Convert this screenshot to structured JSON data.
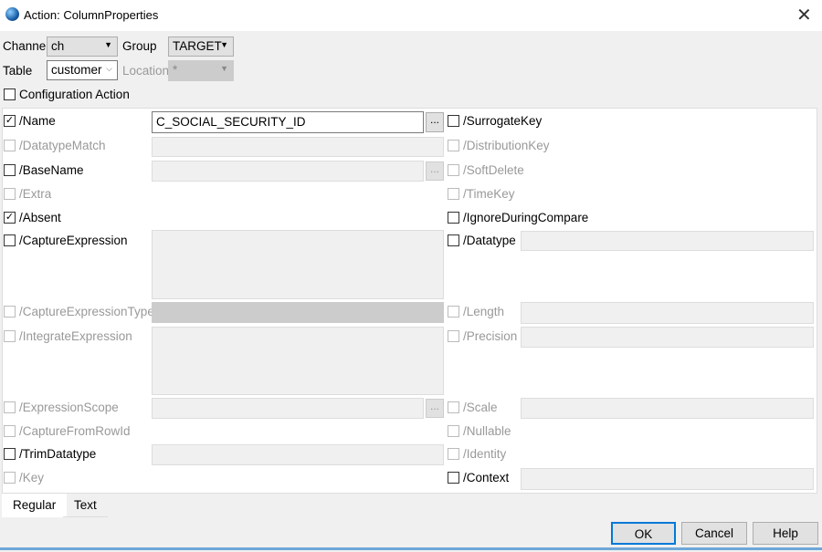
{
  "window": {
    "title": "Action: ColumnProperties",
    "close": "✕"
  },
  "header": {
    "channel_label": "Channel",
    "channel_value": "ch",
    "group_label": "Group",
    "group_value": "TARGET",
    "table_label": "Table",
    "table_value": "customer",
    "location_label": "Location",
    "location_value": "*",
    "config_action_label": "Configuration Action",
    "config_action_checked": false
  },
  "left_rows": [
    {
      "label": "/Name",
      "checked": true,
      "enabled": true,
      "value": "C_SOCIAL_SECURITY_ID"
    },
    {
      "label": "/DatatypeMatch",
      "checked": false,
      "enabled": false
    },
    {
      "label": "/BaseName",
      "checked": false,
      "enabled": true
    },
    {
      "label": "/Extra",
      "checked": false,
      "enabled": false
    },
    {
      "label": "/Absent",
      "checked": true,
      "enabled": true
    },
    {
      "label": "/CaptureExpression",
      "checked": false,
      "enabled": true
    },
    {
      "label": "/CaptureExpressionType",
      "checked": false,
      "enabled": false
    },
    {
      "label": "/IntegrateExpression",
      "checked": false,
      "enabled": false
    },
    {
      "label": "/ExpressionScope",
      "checked": false,
      "enabled": false
    },
    {
      "label": "/CaptureFromRowId",
      "checked": false,
      "enabled": false
    },
    {
      "label": "/TrimDatatype",
      "checked": false,
      "enabled": true
    },
    {
      "label": "/Key",
      "checked": false,
      "enabled": false
    }
  ],
  "right_rows": [
    {
      "label": "/SurrogateKey",
      "checked": false,
      "enabled": true
    },
    {
      "label": "/DistributionKey",
      "checked": false,
      "enabled": false
    },
    {
      "label": "/SoftDelete",
      "checked": false,
      "enabled": false
    },
    {
      "label": "/TimeKey",
      "checked": false,
      "enabled": false
    },
    {
      "label": "/IgnoreDuringCompare",
      "checked": false,
      "enabled": true
    },
    {
      "label": "/Datatype",
      "checked": false,
      "enabled": true
    },
    {
      "label": "/Length",
      "checked": false,
      "enabled": false
    },
    {
      "label": "/Precision",
      "checked": false,
      "enabled": false
    },
    {
      "label": "/Scale",
      "checked": false,
      "enabled": false
    },
    {
      "label": "/Nullable",
      "checked": false,
      "enabled": false
    },
    {
      "label": "/Identity",
      "checked": false,
      "enabled": false
    },
    {
      "label": "/Context",
      "checked": false,
      "enabled": true
    }
  ],
  "ellipsis": "...",
  "tabs": [
    {
      "label": "Regular",
      "active": true
    },
    {
      "label": "Text",
      "active": false
    }
  ],
  "buttons": {
    "ok": "OK",
    "cancel": "Cancel",
    "help": "Help"
  },
  "colors": {
    "accent": "#0078d7"
  }
}
